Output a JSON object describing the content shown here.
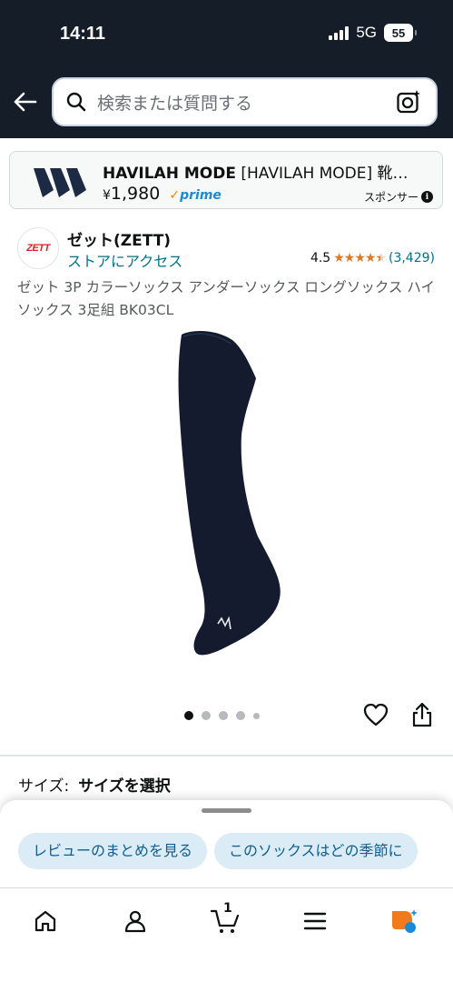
{
  "status": {
    "time": "14:11",
    "network": "5G",
    "battery": "55"
  },
  "search": {
    "placeholder": "検索または質問する"
  },
  "sponsor": {
    "brand": "HAVILAH MODE",
    "title_rest": " [HAVILAH MODE] 靴…",
    "currency": "¥",
    "price": "1,980",
    "prime": "prime",
    "label": "スポンサー"
  },
  "product": {
    "brand_logo_text": "ZETT",
    "brand_name": "ゼット(ZETT)",
    "store_link": "ストアにアクセス",
    "rating": "4.5",
    "rating_count": "(3,429)",
    "title": "ゼット 3P カラーソックス アンダーソックス ロングソックス ハイソックス 3足組 BK03CL",
    "image_count": 5,
    "active_image": 1
  },
  "size": {
    "label": "サイズ:",
    "value": "サイズを選択"
  },
  "chips": [
    "レビューのまとめを見る",
    "このソックスはどの季節に"
  ],
  "nav": {
    "cart_count": "1"
  },
  "colors": {
    "header_bg": "#141d28",
    "link": "#007185",
    "star": "#de7921",
    "chip_bg": "#dbecf7",
    "sock": "#141b2e"
  }
}
